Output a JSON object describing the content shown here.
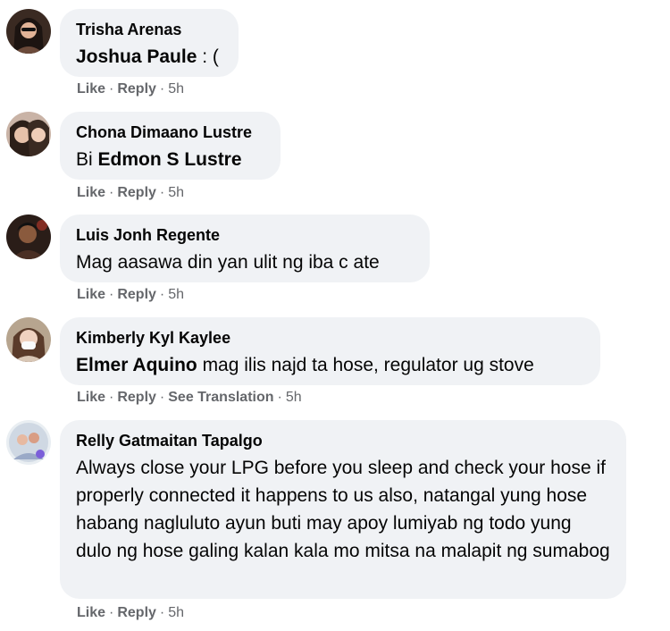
{
  "comments": [
    {
      "author": "Trisha Arenas",
      "tag": "Joshua Paule",
      "text": " : (",
      "actions": {
        "like": "Like",
        "reply": "Reply",
        "time": "5h"
      }
    },
    {
      "author": "Chona Dimaano Lustre",
      "prefix": "Bi ",
      "tag": "Edmon S Lustre",
      "actions": {
        "like": "Like",
        "reply": "Reply",
        "time": "5h"
      }
    },
    {
      "author": "Luis Jonh Regente",
      "text": "Mag aasawa din yan ulit ng iba c ate",
      "actions": {
        "like": "Like",
        "reply": "Reply",
        "time": "5h"
      }
    },
    {
      "author": "Kimberly Kyl Kaylee",
      "tag": "Elmer Aquino",
      "text": " mag ilis najd ta hose, regulator ug stove",
      "actions": {
        "like": "Like",
        "reply": "Reply",
        "translate": "See Translation",
        "time": "5h"
      }
    },
    {
      "author": "Relly Gatmaitan Tapalgo",
      "text": "Always close your LPG before you sleep and check your hose if properly connected it happens to us also, natangal yung hose habang nagluluto ayun buti may apoy lumiyab ng todo yung dulo ng hose galing kalan kala mo mitsa na malapit ng sumabog",
      "actions": {
        "like": "Like",
        "reply": "Reply",
        "time": "5h"
      }
    }
  ],
  "colors": {
    "bubble": "#f0f2f5",
    "text": "#050505",
    "meta": "#65676b"
  }
}
